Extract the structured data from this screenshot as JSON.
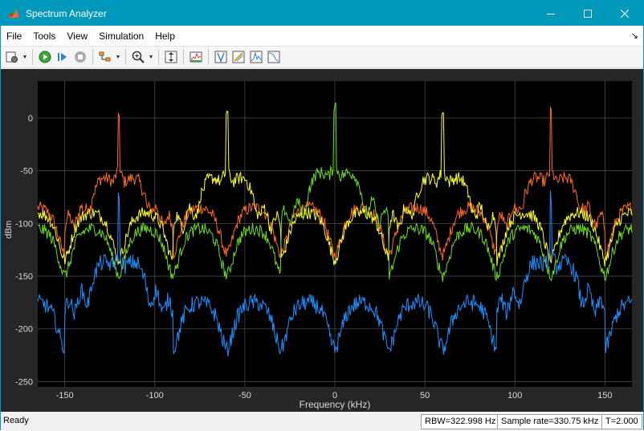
{
  "window": {
    "title": "Spectrum Analyzer"
  },
  "menu": {
    "items": [
      "File",
      "Tools",
      "View",
      "Simulation",
      "Help"
    ]
  },
  "toolbar": {
    "icons": [
      "settings-icon",
      "run-icon",
      "step-icon",
      "stop-icon",
      "signal-tree-icon",
      "zoom-in-icon",
      "autoscale-icon",
      "spectrum-settings-icon",
      "trigger-icon",
      "cursor-icon",
      "peak-finder-icon",
      "ccdf-icon"
    ]
  },
  "status": {
    "ready": "Ready",
    "rbw": "RBW=322.998 Hz",
    "sample_rate": "Sample rate=330.75 kHz",
    "time": "T=2.000"
  },
  "colors": {
    "orange": "#ff6a2a",
    "yellow": "#ffff2e",
    "green": "#6fdc1e",
    "blue": "#1e90ff",
    "grid": "#4a4a4a",
    "axes_bg": "#000000",
    "figure_bg": "#262626"
  },
  "chart_data": {
    "type": "line",
    "xlabel": "Frequency (kHz)",
    "ylabel": "dBm",
    "xlim": [
      -165,
      165
    ],
    "ylim": [
      -255,
      35
    ],
    "xticks": [
      -150,
      -100,
      -50,
      0,
      50,
      100,
      150
    ],
    "yticks": [
      0,
      -50,
      -100,
      -150,
      -200,
      -250
    ],
    "grid": true,
    "series": [
      {
        "color": "#ff6a2a",
        "carriers": [
          -120,
          120
        ],
        "peak": 5,
        "shoulder": -60,
        "floor": -110
      },
      {
        "color": "#ffff2e",
        "carriers": [
          -60,
          60
        ],
        "peak": 5,
        "shoulder": -60,
        "floor": -115
      },
      {
        "color": "#6fdc1e",
        "carriers": [
          0
        ],
        "peak": 12,
        "shoulder": -55,
        "floor": -130
      },
      {
        "color": "#1e90ff",
        "carriers": [
          -120,
          120
        ],
        "peak": -75,
        "shoulder": -140,
        "floor": -200
      }
    ]
  }
}
